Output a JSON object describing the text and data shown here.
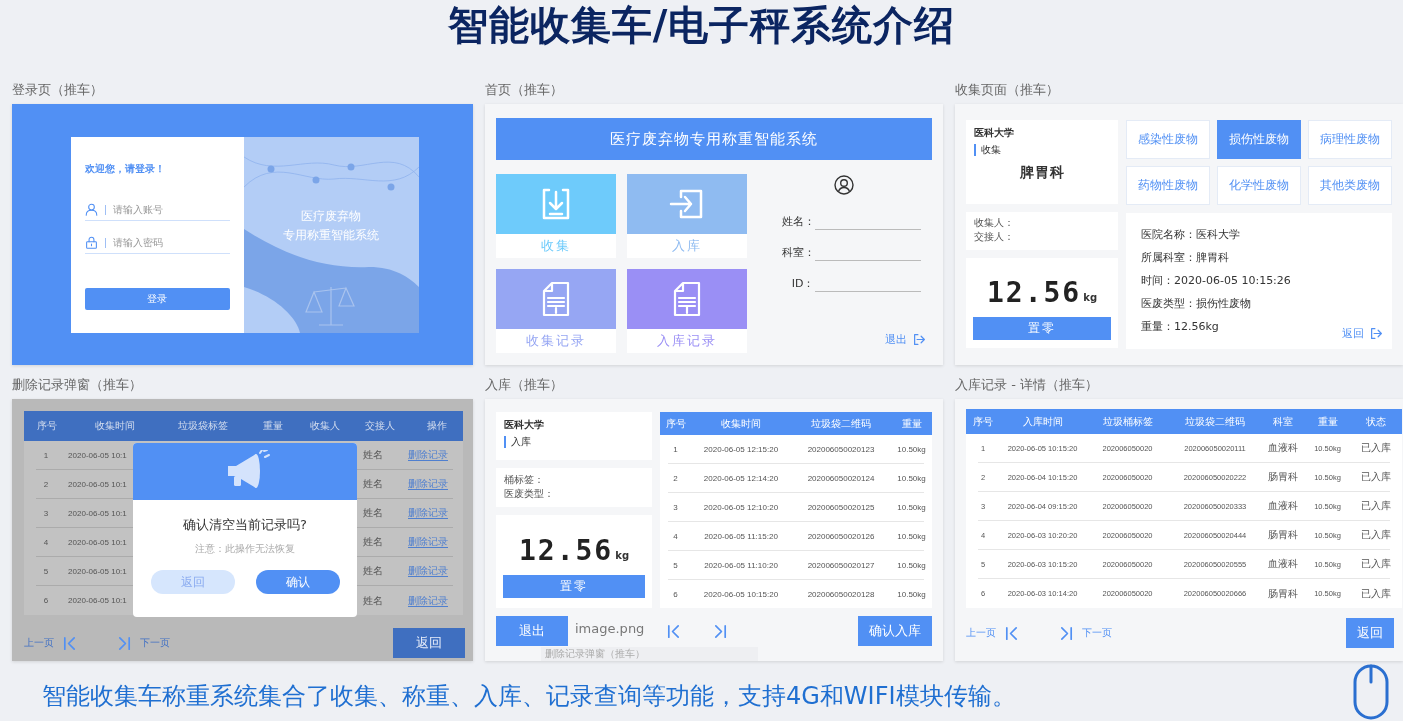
{
  "title": "智能收集车/电子秤系统介绍",
  "panels": [
    {
      "kind": "login",
      "caption": "登录页（推车）",
      "welcome": "欢迎您，请登录！",
      "fields": [
        {
          "kind": "user",
          "placeholder": "请输入账号"
        },
        {
          "kind": "lock",
          "placeholder": "请输入密码"
        }
      ],
      "button": "登录",
      "banner": [
        "医疗废弃物",
        "专用称重智能系统"
      ]
    },
    {
      "kind": "home",
      "caption": "首页（推车）",
      "header": "医疗废弃物专用称重智能系统",
      "tiles": [
        {
          "label": "收集",
          "color": "#6ecbfb"
        },
        {
          "label": "入库",
          "color": "#8fbbf1"
        },
        {
          "label": "收集记录",
          "color": "#96a6f3"
        },
        {
          "label": "入库记录",
          "color": "#9a8ff5"
        }
      ],
      "profile": [
        "姓名：",
        "科室：",
        "ID："
      ],
      "logout": "退出"
    },
    {
      "kind": "collect",
      "caption": "收集页面（推车）",
      "hospital": "医科大学",
      "section": "收集",
      "department": "脾胃科",
      "people": [
        "收集人：",
        "交接人："
      ],
      "weight": "12.56",
      "unit": "kg",
      "zero_button": "置零",
      "categories": [
        {
          "label": "感染性废物",
          "selected": false
        },
        {
          "label": "损伤性废物",
          "selected": true
        },
        {
          "label": "病理性废物",
          "selected": false
        },
        {
          "label": "药物性废物",
          "selected": false
        },
        {
          "label": "化学性废物",
          "selected": false
        },
        {
          "label": "其他类废物",
          "selected": false
        }
      ],
      "details": [
        "医院名称：医科大学",
        "所属科室：脾胃科",
        "时间：2020-06-05  10:15:26",
        "医废类型：损伤性废物",
        "重量：12.56kg"
      ],
      "back": "返回"
    },
    {
      "kind": "delete_dialog",
      "caption": "删除记录弹窗（推车）",
      "columns": [
        "序号",
        "收集时间",
        "垃圾袋标签",
        "重量",
        "收集人",
        "交接人",
        "操作"
      ],
      "rows": [
        {
          "seq": "1",
          "time": "2020-06-05 10:1",
          "handover": "姓名",
          "action": "删除记录"
        },
        {
          "seq": "2",
          "time": "2020-06-05 10:1",
          "handover": "姓名",
          "action": "删除记录"
        },
        {
          "seq": "3",
          "time": "2020-06-05 10:1",
          "handover": "姓名",
          "action": "删除记录"
        },
        {
          "seq": "4",
          "time": "2020-06-05 10:1",
          "handover": "姓名",
          "action": "删除记录"
        },
        {
          "seq": "5",
          "time": "2020-06-05 10:1",
          "handover": "姓名",
          "action": "删除记录"
        },
        {
          "seq": "6",
          "time": "2020-06-05 10:1",
          "handover": "姓名",
          "action": "删除记录"
        }
      ],
      "dialog": {
        "title": "确认清空当前记录吗?",
        "note": "注意：此操作无法恢复",
        "cancel": "返回",
        "confirm": "确认"
      },
      "prev": "上一页",
      "next": "下一页",
      "back": "返回"
    },
    {
      "kind": "warehouse",
      "caption": "入库（推车）",
      "hospital": "医科大学",
      "section": "入库",
      "fields": [
        "桶标签：",
        "医废类型："
      ],
      "weight": "12.56",
      "unit": "kg",
      "zero_button": "置零",
      "columns": [
        "序号",
        "收集时间",
        "垃圾袋二维码",
        "重量"
      ],
      "rows": [
        [
          "1",
          "2020-06-05 12:15:20",
          "202006050020123",
          "10.50kg"
        ],
        [
          "2",
          "2020-06-05 12:14:20",
          "202006050020124",
          "10.50kg"
        ],
        [
          "3",
          "2020-06-05 12:10:20",
          "202006050020125",
          "10.50kg"
        ],
        [
          "4",
          "2020-06-05 11:15:20",
          "202006050020126",
          "10.50kg"
        ],
        [
          "5",
          "2020-06-05 11:10:20",
          "202006050020127",
          "10.50kg"
        ],
        [
          "6",
          "2020-06-05 10:15:20",
          "202006050020128",
          "10.50kg"
        ]
      ],
      "exit": "退出",
      "confirm": "确认入库",
      "drag_ghost": {
        "filename": "image.png",
        "caption": "删除记录弹窗（推车）"
      }
    },
    {
      "kind": "records",
      "caption": "入库记录 - 详情（推车）",
      "columns": [
        "序号",
        "入库时间",
        "垃圾桶标签",
        "垃圾袋二维码",
        "科室",
        "重量",
        "状态"
      ],
      "rows": [
        [
          "1",
          "2020-06-05 10:15:20",
          "202006050020",
          "202006050020111",
          "血液科",
          "10.50kg",
          "已入库"
        ],
        [
          "2",
          "2020-06-04 10:15:20",
          "202006050020",
          "202006050020222",
          "肠胃科",
          "10.50kg",
          "已入库"
        ],
        [
          "3",
          "2020-06-04 09:15:20",
          "202006050020",
          "202006050020333",
          "血液科",
          "10.50kg",
          "已入库"
        ],
        [
          "4",
          "2020-06-03 10:20:20",
          "202006050020",
          "202006050020444",
          "肠胃科",
          "10.50kg",
          "已入库"
        ],
        [
          "5",
          "2020-06-03 10:15:20",
          "202006050020",
          "202006050020555",
          "血液科",
          "10.50kg",
          "已入库"
        ],
        [
          "6",
          "2020-06-03 10:14:20",
          "202006050020",
          "202006050020666",
          "肠胃科",
          "10.50kg",
          "已入库"
        ]
      ],
      "prev": "上一页",
      "next": "下一页",
      "back": "返回"
    }
  ],
  "footer": "智能收集车称重系统集合了收集、称重、入库、记录查询等功能，支持4G和WIFI模块传输。"
}
